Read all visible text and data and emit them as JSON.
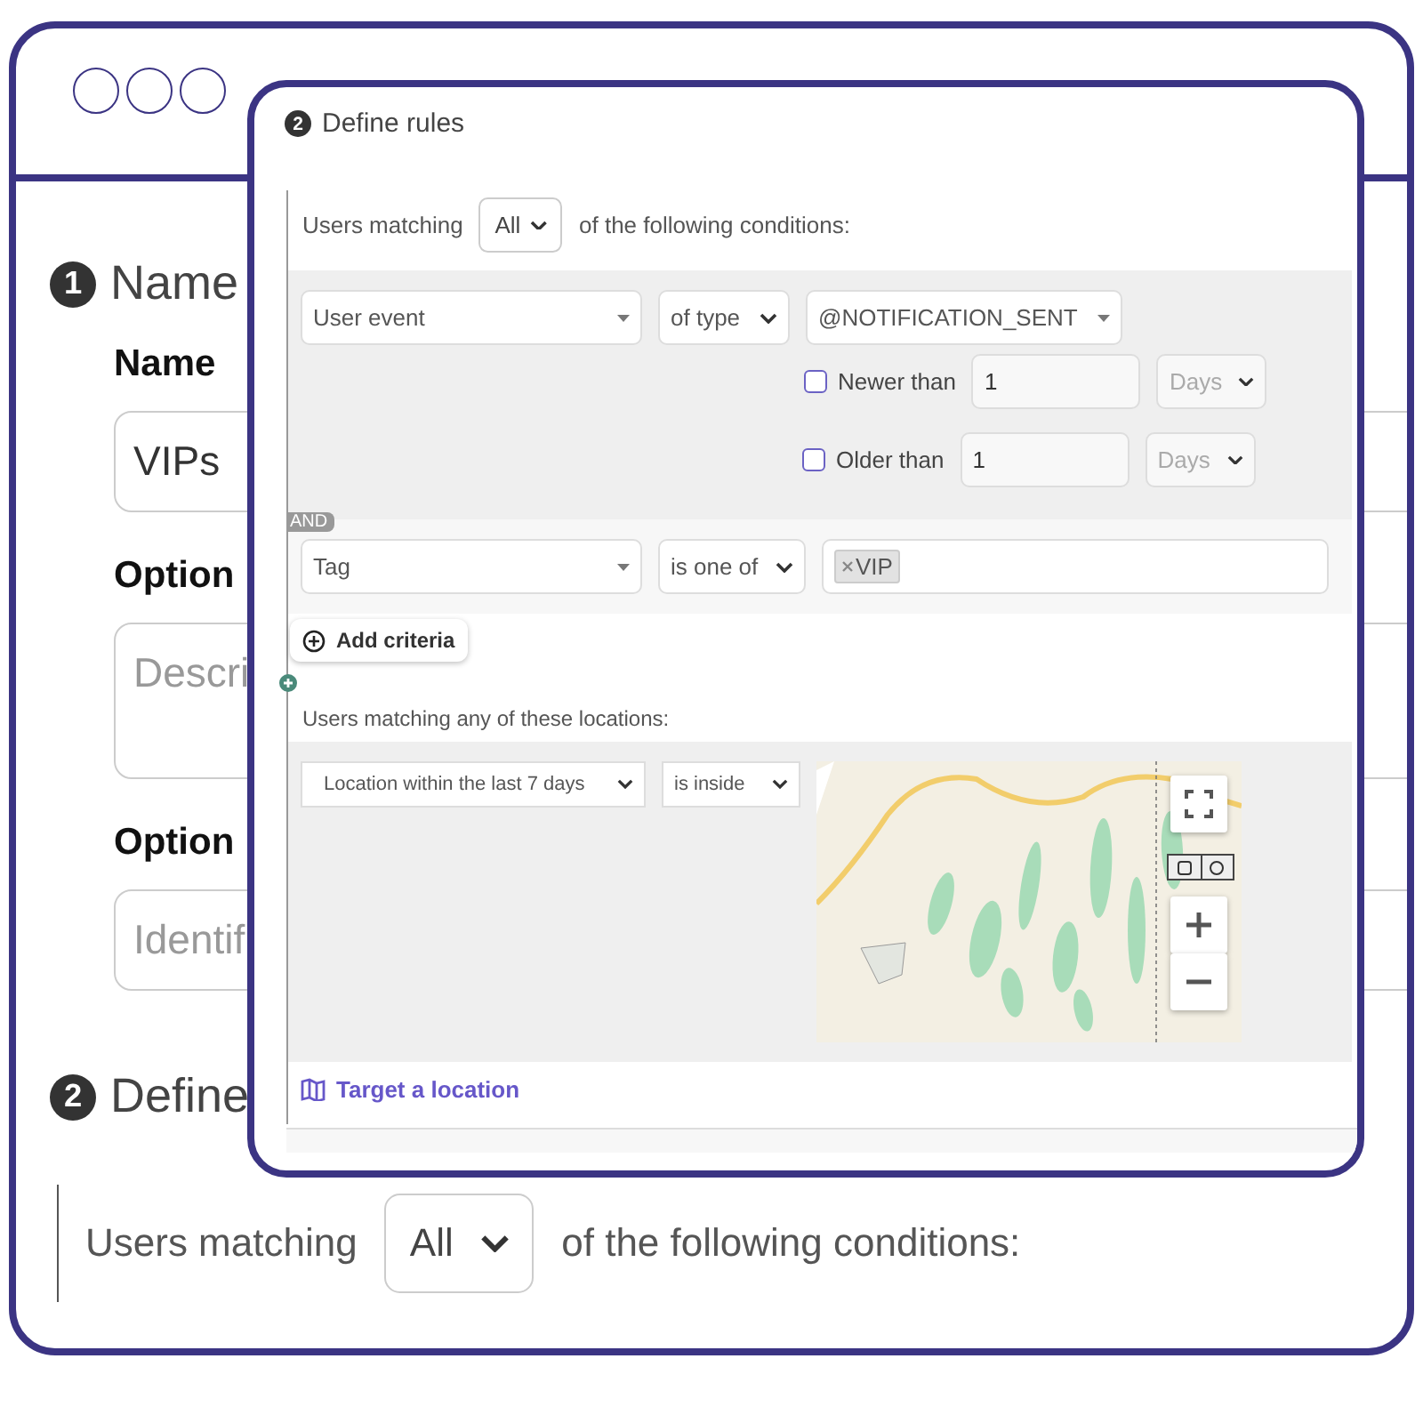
{
  "back_form": {
    "step_one": {
      "number": "1",
      "title": "Name"
    },
    "fields": [
      {
        "kind": "input",
        "label": "Name",
        "value": "VIPs"
      },
      {
        "kind": "textarea",
        "label": "Option",
        "placeholder": "Descri"
      },
      {
        "kind": "input",
        "label": "Option",
        "placeholder": "Identif"
      }
    ],
    "step_two": {
      "number": "2",
      "title": "Define"
    },
    "match": {
      "prefix": "Users matching",
      "value": "All",
      "suffix": "of the following conditions:"
    }
  },
  "rules_panel": {
    "step": {
      "number": "2",
      "title": "Define rules"
    },
    "match": {
      "prefix": "Users matching",
      "value": "All",
      "suffix": "of the following conditions:"
    },
    "conditions": [
      {
        "kind": "event",
        "field": "User event",
        "operator": "of type",
        "value": "@NOTIFICATION_SENT",
        "filters": [
          {
            "label": "Newer than",
            "checked": false,
            "amount": "1",
            "unit": "Days"
          },
          {
            "label": "Older than",
            "checked": false,
            "amount": "1",
            "unit": "Days"
          }
        ]
      },
      {
        "kind": "tag",
        "joiner": "AND",
        "field": "Tag",
        "operator": "is one of",
        "tags": [
          "VIP"
        ]
      }
    ],
    "add_button": "Add criteria",
    "locations": {
      "heading": "Users matching any of these locations:",
      "field": "Location within the last 7 days",
      "operator": "is inside"
    },
    "target_link": "Target a location"
  }
}
